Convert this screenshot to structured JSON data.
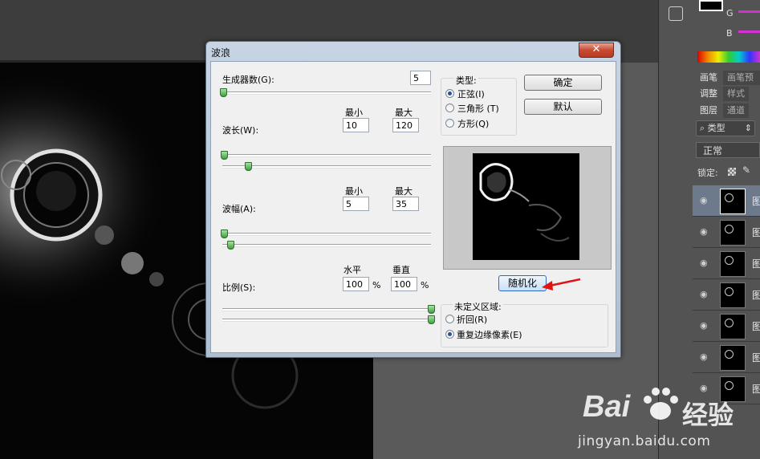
{
  "panels": {
    "color_labels": [
      "G",
      "B"
    ],
    "colors": {
      "g_slider": "#d430d4",
      "b_slider": "#d430d4"
    },
    "tabs_row1": [
      "画笔",
      "画笔预设"
    ],
    "tabs_row2": [
      "调整",
      "样式"
    ],
    "tabs_row3": [
      "图层",
      "通道"
    ],
    "filter_kind": "类型",
    "blend_mode": "正常",
    "lock_label": "锁定:",
    "layers": [
      "图",
      "图",
      "图",
      "图",
      "图",
      "图",
      "图"
    ]
  },
  "dialog": {
    "title": "波浪",
    "close_glyph": "✕",
    "generators": {
      "label": "生成器数(G):",
      "value": "5"
    },
    "wavelength": {
      "label": "波长(W):",
      "min_label": "最小",
      "max_label": "最大",
      "min": "10",
      "max": "120"
    },
    "amplitude": {
      "label": "波幅(A):",
      "min_label": "最小",
      "max_label": "最大",
      "min": "5",
      "max": "35"
    },
    "scale": {
      "label": "比例(S):",
      "h_label": "水平",
      "v_label": "垂直",
      "h": "100",
      "v": "100",
      "unit": "%"
    },
    "type_group": {
      "title": "类型:",
      "options": [
        "正弦(I)",
        "三角形 (T)",
        "方形(Q)"
      ],
      "selected": 0
    },
    "ok_label": "确定",
    "default_label": "默认",
    "randomize_label": "随机化",
    "undefined_group": {
      "title": "未定义区域:",
      "options": [
        "折回(R)",
        "重复边缘像素(E)"
      ],
      "selected": 1
    }
  },
  "watermark": {
    "brand": "Bai",
    "brand_tail": "经验",
    "url": "jingyan.baidu.com",
    "colors": {
      "paw": "#ffffff"
    }
  }
}
